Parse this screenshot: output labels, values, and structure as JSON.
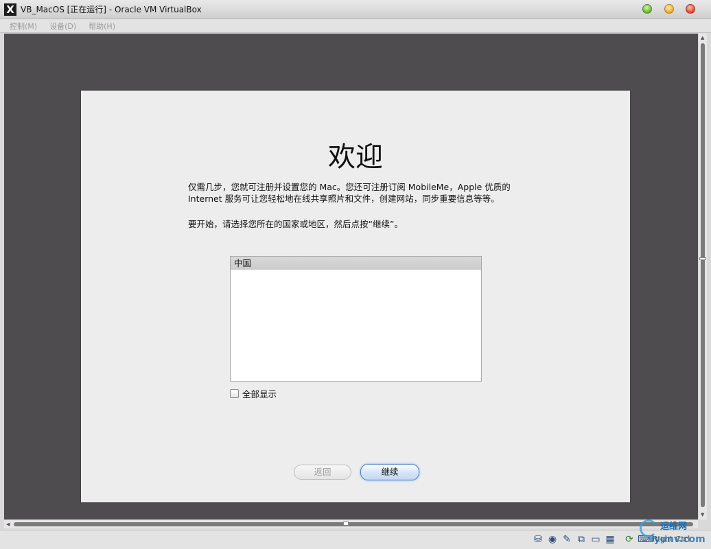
{
  "window": {
    "title": "VB_MacOS [正在运行] - Oracle VM VirtualBox",
    "app_icon": "X"
  },
  "menu": {
    "items": [
      {
        "label": "控制(M)"
      },
      {
        "label": "设备(D)"
      },
      {
        "label": "帮助(H)"
      }
    ]
  },
  "setup": {
    "heading": "欢迎",
    "intro_line1": "仅需几步，您就可注册并设置您的 Mac。您还可注册订阅 MobileMe，Apple 优质的",
    "intro_line2": "Internet 服务可让您轻松地在线共享照片和文件，创建网站，同步重要信息等等。",
    "instruction": "要开始，请选择您所在的国家或地区，然后点按“继续”。",
    "countries": [
      "中国"
    ],
    "show_all_label": "全部显示",
    "show_all_checked": false,
    "back_label": "返回",
    "continue_label": "继续"
  },
  "statusbar": {
    "host_key": "Right Ctrl",
    "icons": [
      "hard-disk-icon",
      "optical-drive-icon",
      "pencil-icon",
      "network-icon",
      "folder-icon",
      "chip-icon",
      "mouse-integration-icon",
      "keyboard-capture-icon"
    ]
  },
  "watermark": {
    "line1": "运维网",
    "line2": "iyunv.com"
  }
}
